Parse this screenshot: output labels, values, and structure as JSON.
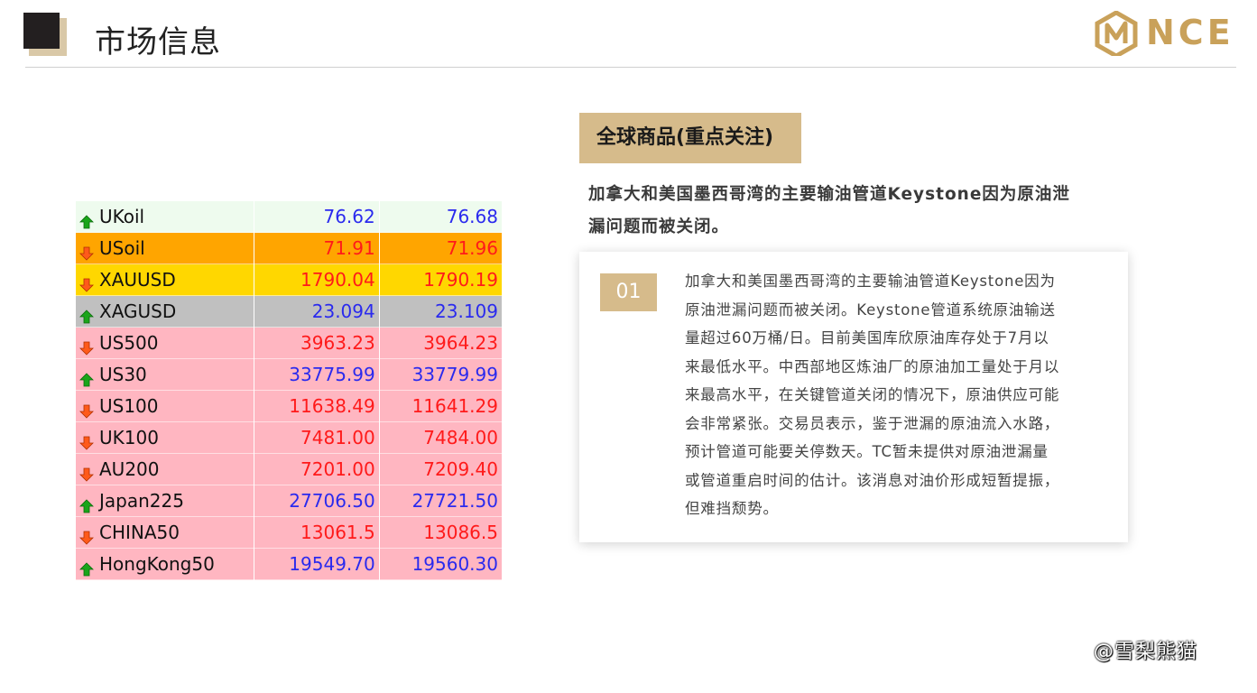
{
  "header": {
    "title": "市场信息",
    "logo_text": "NCE"
  },
  "quotes": [
    {
      "symbol": "UKoil",
      "bid": "76.62",
      "ask": "76.68",
      "direction": "up",
      "row_color": "#eefbee",
      "value_color": "#2a2aee"
    },
    {
      "symbol": "USoil",
      "bid": "71.91",
      "ask": "71.96",
      "direction": "down",
      "row_color": "#ffa500",
      "value_color": "#ff1a1a"
    },
    {
      "symbol": "XAUUSD",
      "bid": "1790.04",
      "ask": "1790.19",
      "direction": "down",
      "row_color": "#ffd700",
      "value_color": "#ff1a1a"
    },
    {
      "symbol": "XAGUSD",
      "bid": "23.094",
      "ask": "23.109",
      "direction": "up",
      "row_color": "#c0c0c0",
      "value_color": "#2a2aee"
    },
    {
      "symbol": "US500",
      "bid": "3963.23",
      "ask": "3964.23",
      "direction": "down",
      "row_color": "#ffb6c1",
      "value_color": "#ff1a1a"
    },
    {
      "symbol": "US30",
      "bid": "33775.99",
      "ask": "33779.99",
      "direction": "up",
      "row_color": "#ffb6c1",
      "value_color": "#2a2aee"
    },
    {
      "symbol": "US100",
      "bid": "11638.49",
      "ask": "11641.29",
      "direction": "down",
      "row_color": "#ffb6c1",
      "value_color": "#ff1a1a"
    },
    {
      "symbol": "UK100",
      "bid": "7481.00",
      "ask": "7484.00",
      "direction": "down",
      "row_color": "#ffb6c1",
      "value_color": "#ff1a1a"
    },
    {
      "symbol": "AU200",
      "bid": "7201.00",
      "ask": "7209.40",
      "direction": "down",
      "row_color": "#ffb6c1",
      "value_color": "#ff1a1a"
    },
    {
      "symbol": "Japan225",
      "bid": "27706.50",
      "ask": "27721.50",
      "direction": "up",
      "row_color": "#ffb6c1",
      "value_color": "#2a2aee"
    },
    {
      "symbol": "CHINA50",
      "bid": "13061.5",
      "ask": "13086.5",
      "direction": "down",
      "row_color": "#ffb6c1",
      "value_color": "#ff1a1a"
    },
    {
      "symbol": "HongKong50",
      "bid": "19549.70",
      "ask": "19560.30",
      "direction": "up",
      "row_color": "#ffb6c1",
      "value_color": "#2a2aee"
    }
  ],
  "section": {
    "tag": "全球商品(重点关注)",
    "headline_line1": "加拿大和美国墨西哥湾的主要输油管道Keystone因为原油泄",
    "headline_line2": "漏问题而被关闭。"
  },
  "card": {
    "badge": "01",
    "lines": [
      "加拿大和美国墨西哥湾的主要输油管道Keystone因为",
      "原油泄漏问题而被关闭。Keystone管道系统原油输送",
      "量超过60万桶/日。目前美国库欣原油库存处于7月以",
      "来最低水平。中西部地区炼油厂的原油加工量处于月以",
      "来最高水平，在关键管道关闭的情况下，原油供应可能",
      "会非常紧张。交易员表示，鉴于泄漏的原油流入水路，",
      "预计管道可能要关停数天。TC暂未提供对原油泄漏量",
      "或管道重启时间的估计。该消息对油价形成短暂提振，",
      "但难挡颓势。"
    ]
  },
  "watermark": "@雪梨熊猫",
  "colors": {
    "accent": "#d6bb8b",
    "up_arrow": "#1aa51a",
    "down_arrow": "#ff5a1a"
  },
  "icons": {
    "up": "up-arrow-icon",
    "down": "down-arrow-icon"
  }
}
